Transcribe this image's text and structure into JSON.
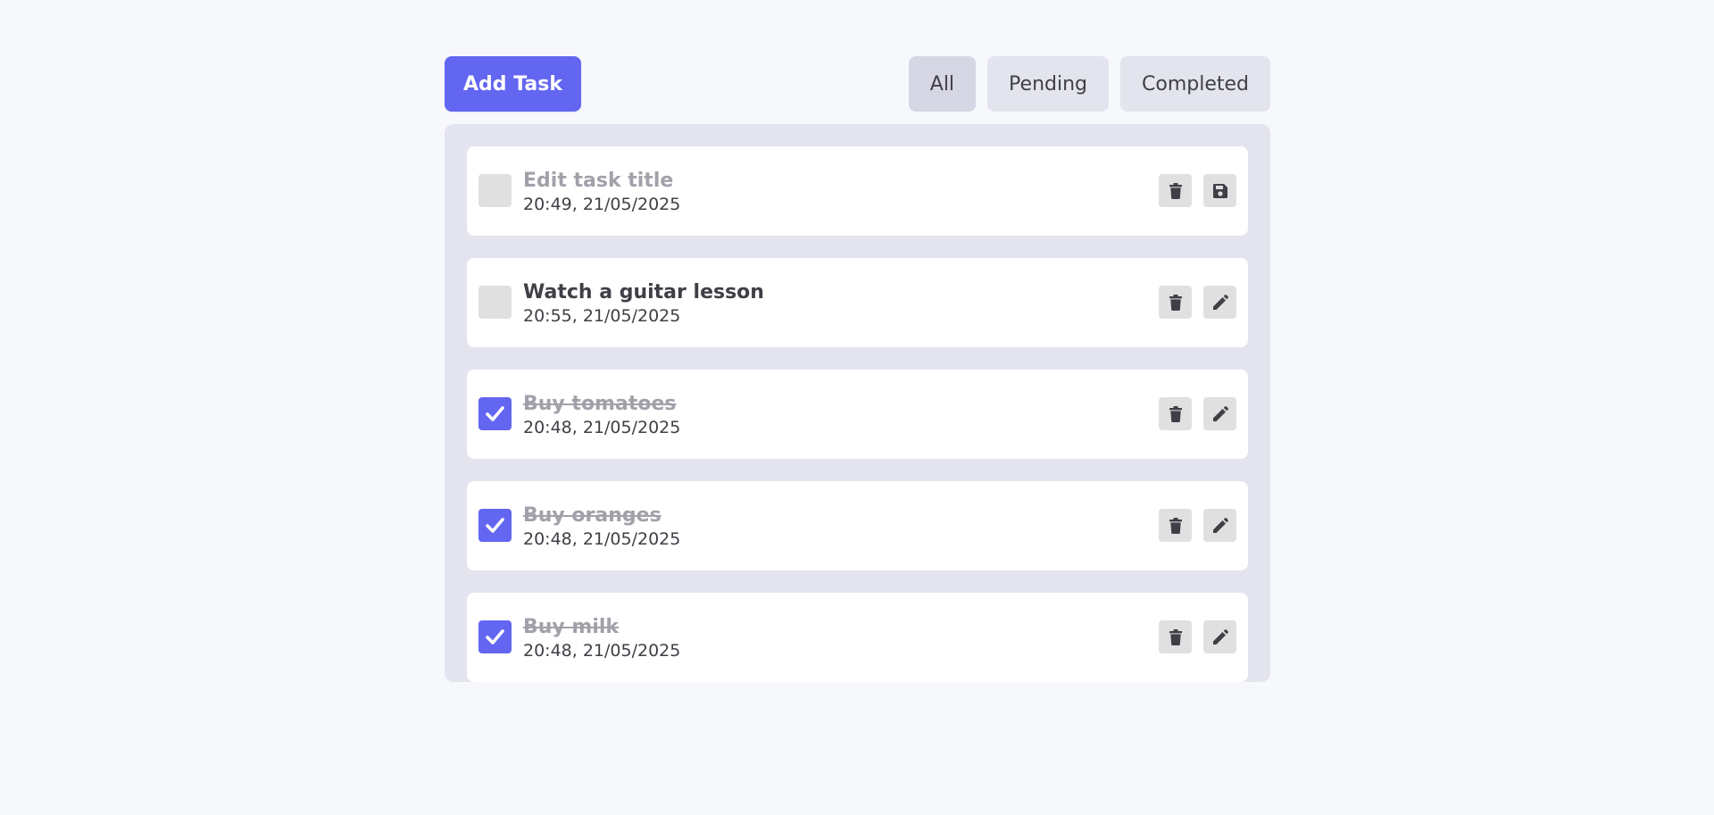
{
  "toolbar": {
    "add_label": "Add Task",
    "filters": [
      "All",
      "Pending",
      "Completed"
    ],
    "active_filter": "All"
  },
  "tasks": [
    {
      "title": "Edit task title",
      "time": "20:49, 21/05/2025",
      "completed": false,
      "editing": true
    },
    {
      "title": "Watch a guitar lesson",
      "time": "20:55, 21/05/2025",
      "completed": false,
      "editing": false
    },
    {
      "title": "Buy tomatoes",
      "time": "20:48, 21/05/2025",
      "completed": true,
      "editing": false
    },
    {
      "title": "Buy oranges",
      "time": "20:48, 21/05/2025",
      "completed": true,
      "editing": false
    },
    {
      "title": "Buy milk",
      "time": "20:48, 21/05/2025",
      "completed": true,
      "editing": false
    }
  ],
  "icons": {
    "delete": "trash-icon",
    "edit": "pencil-icon",
    "save": "save-icon",
    "check": "check-icon"
  },
  "colors": {
    "accent": "#6366f1",
    "background": "#f7f8fc",
    "panel": "#e4e4ef",
    "text": "#3f3f46",
    "muted": "#a1a1aa"
  }
}
